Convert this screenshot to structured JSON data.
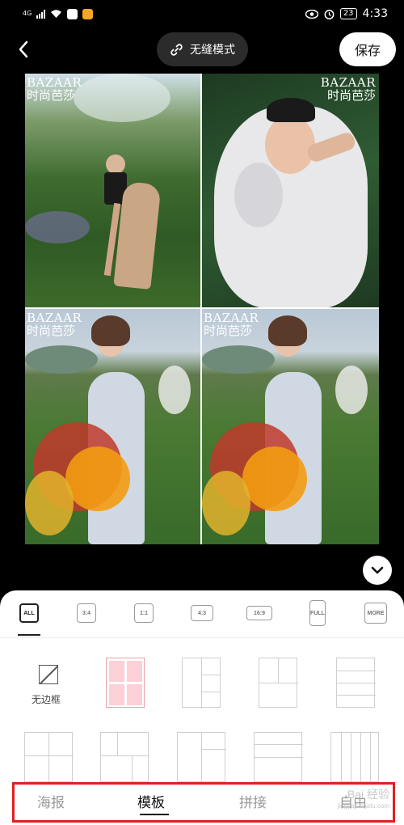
{
  "status_bar": {
    "network": "4G",
    "battery": "23",
    "time": "4:33"
  },
  "header": {
    "mode_label": "无缝模式",
    "save_label": "保存"
  },
  "collage": {
    "brand_line1": "BAZAAR",
    "brand_line2": "时尚芭莎"
  },
  "ratios": [
    "ALL",
    "3:4",
    "1:1",
    "4:3",
    "16:9",
    "FULL",
    "MORE"
  ],
  "templates": {
    "no_border_label": "无边框"
  },
  "tabs": [
    "海报",
    "模板",
    "拼接",
    "自由"
  ],
  "watermark": {
    "line1": "Bai 经验",
    "line2": "jingyan.baidu.com"
  }
}
